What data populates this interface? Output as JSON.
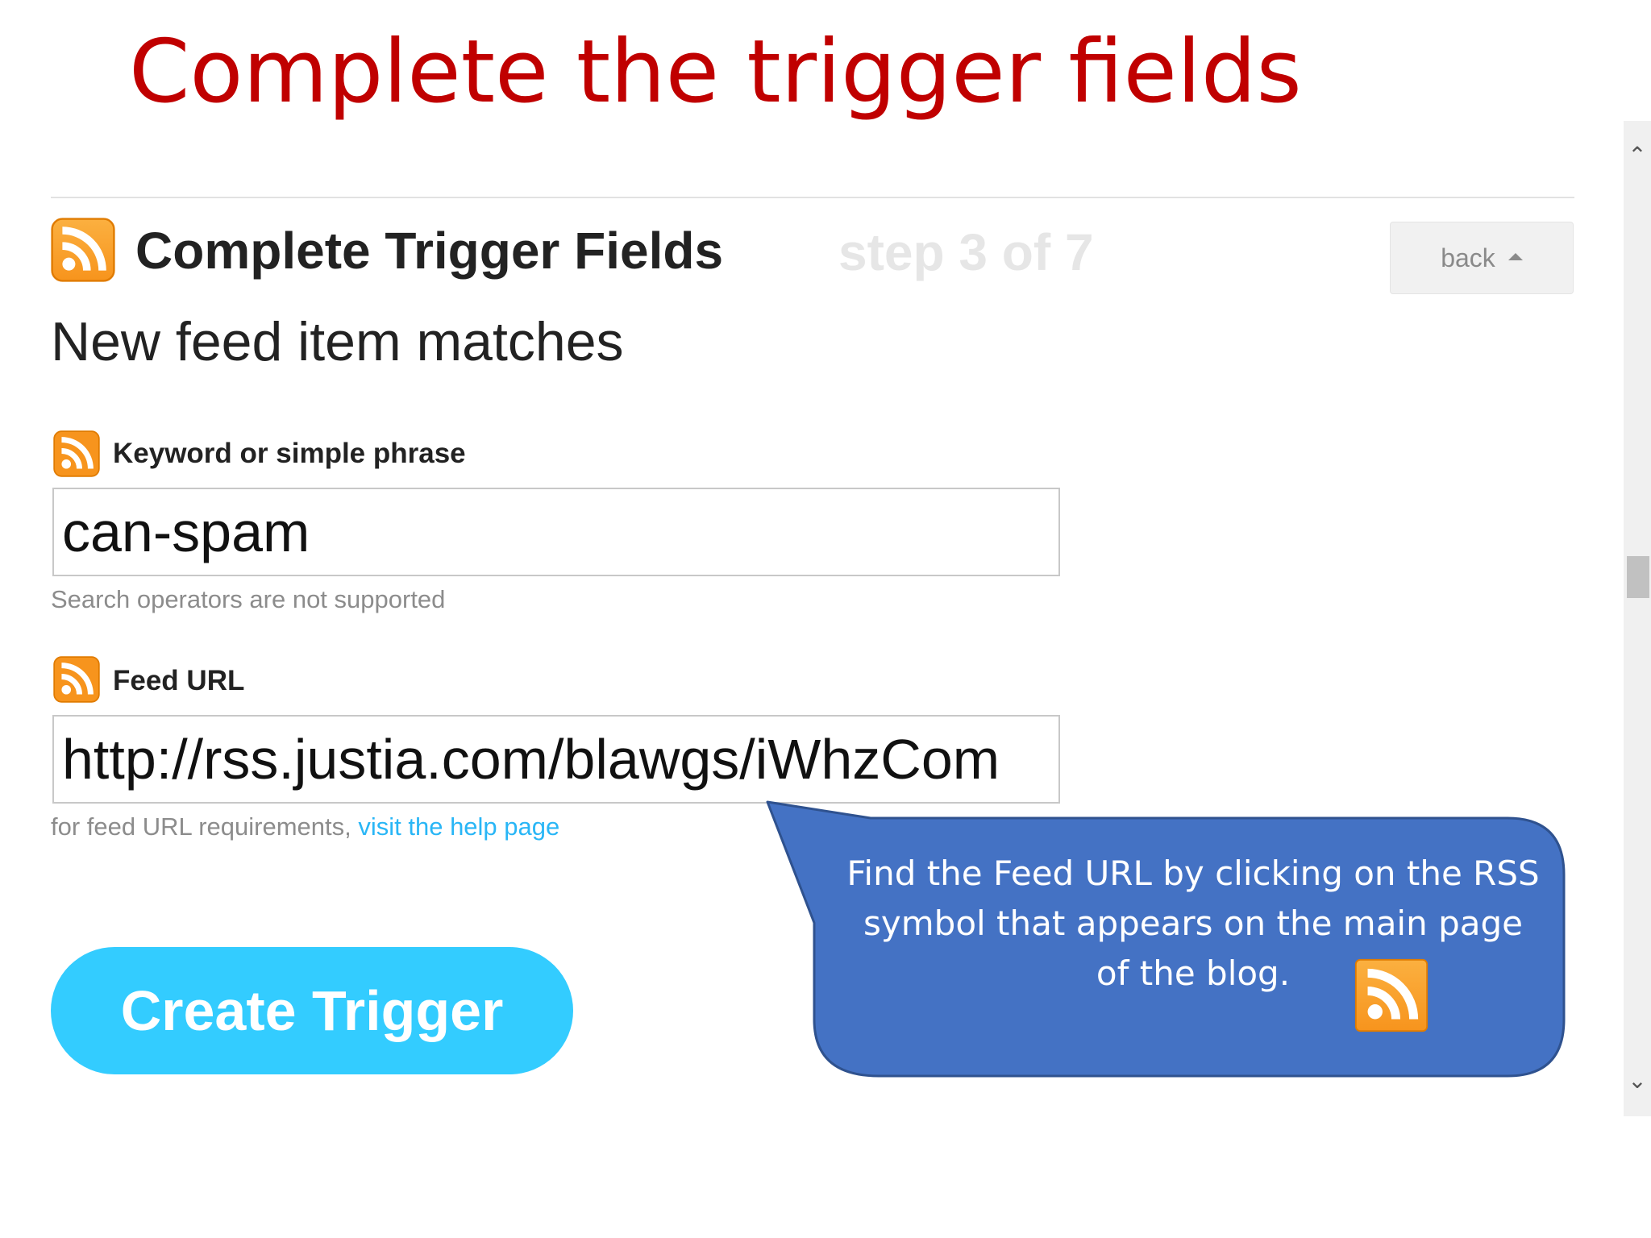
{
  "slide": {
    "title": "Complete the trigger fields"
  },
  "trigger": {
    "heading": "Complete Trigger Fields",
    "step": "step 3 of 7",
    "back_label": "back",
    "subtitle": "New feed item matches"
  },
  "fields": {
    "keyword": {
      "label": "Keyword or simple phrase",
      "value": "can-spam",
      "hint": "Search operators are not supported"
    },
    "feed_url": {
      "label": "Feed URL",
      "value": "http://rss.justia.com/blawgs/iWhzCom",
      "hint_prefix": "for feed URL requirements, ",
      "help_link": "visit the help page"
    }
  },
  "create_button_label": "Create Trigger",
  "callout": {
    "text": "Find the Feed URL by clicking on the RSS symbol that appears on the main page of the blog."
  },
  "icons": {
    "rss": "rss-icon",
    "back_caret": "caret-up-icon",
    "scroll_up": "chevron-up-icon",
    "scroll_down": "chevron-down-icon"
  },
  "colors": {
    "title": "#c00000",
    "rss_orange": "#f7941d",
    "create_button": "#33ccff",
    "link": "#29b6f6",
    "callout_fill": "#4472c4",
    "callout_border": "#2f528f"
  }
}
